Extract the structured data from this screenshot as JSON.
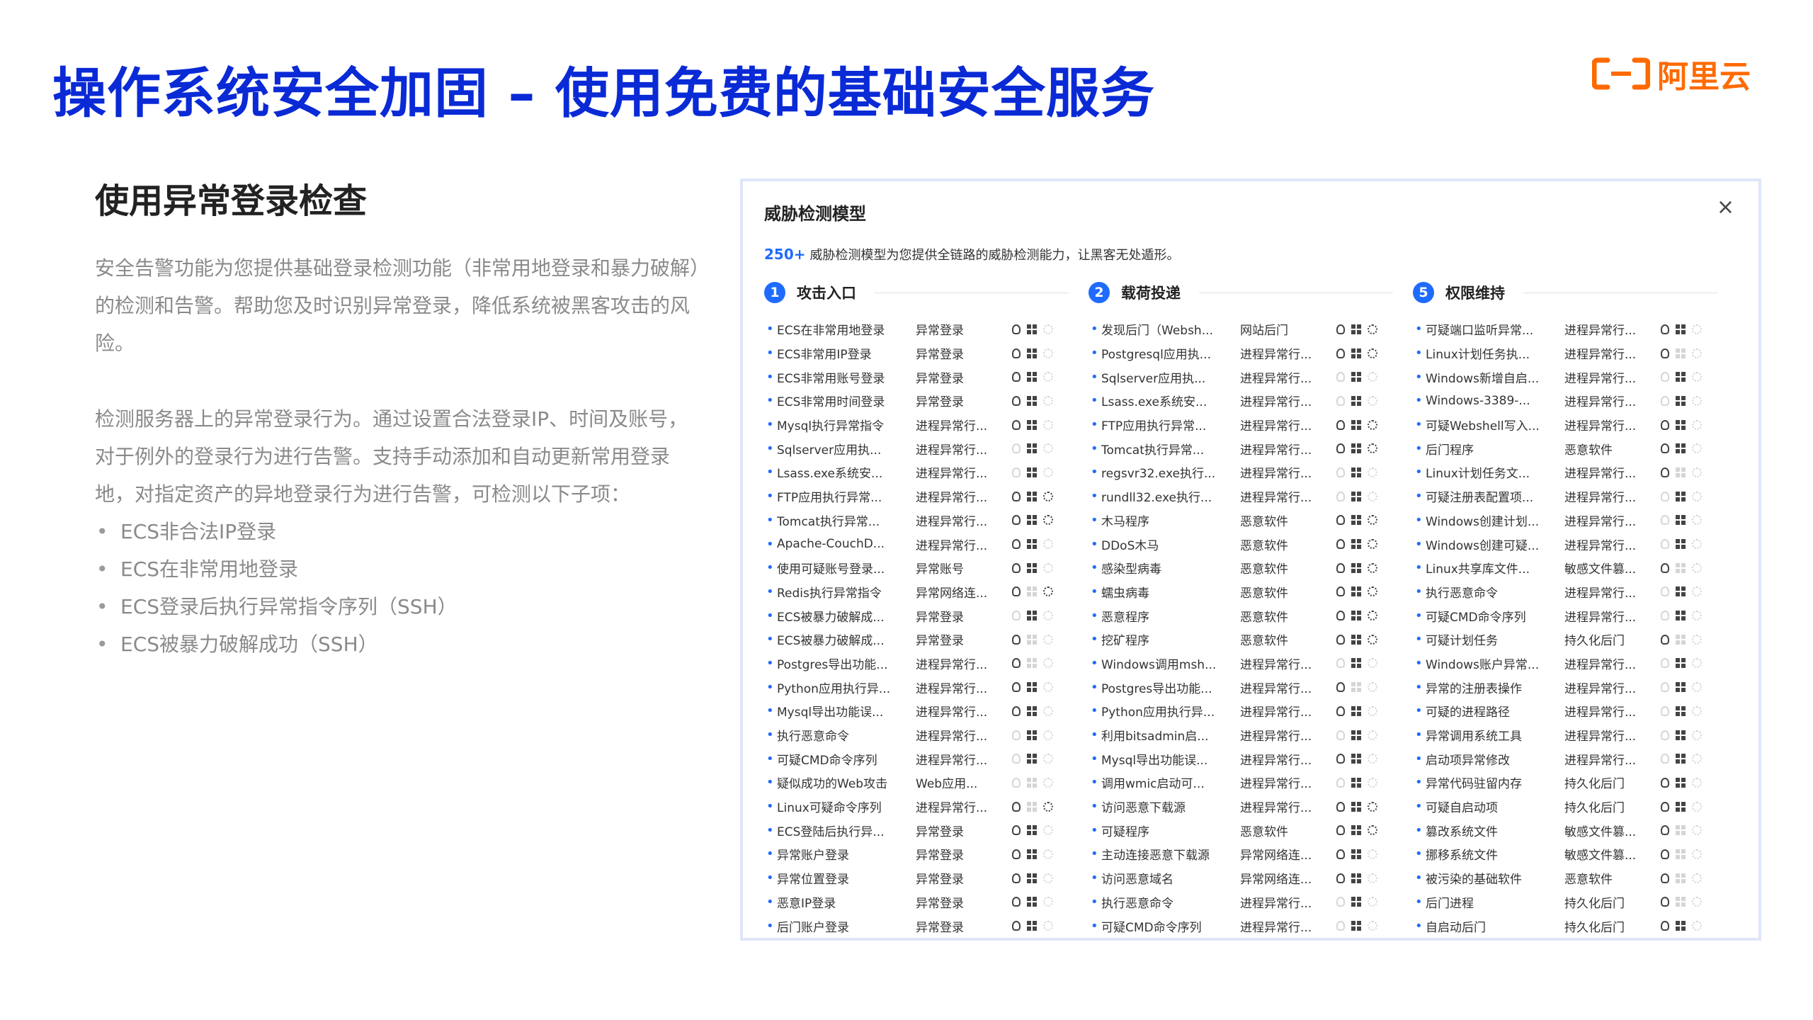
{
  "page": {
    "title": "操作系统安全加固 – 使用免费的基础安全服务",
    "brand": "阿里云"
  },
  "left": {
    "heading": "使用异常登录检查",
    "para1": "安全告警功能为您提供基础登录检测功能（非常用地登录和暴力破解）的检测和告警。帮助您及时识别异常登录，降低系统被黑客攻击的风险。",
    "para2": "检测服务器上的异常登录行为。通过设置合法登录IP、时间及账号，对于例外的登录行为进行告警。支持手动添加和自动更新常用登录地，对指定资产的异地登录行为进行告警，可检测以下子项：",
    "bullets": [
      "ECS非合法IP登录",
      "ECS在非常用地登录",
      "ECS登录后执行异常指令序列（SSH）",
      "ECS被暴力破解成功（SSH）"
    ]
  },
  "panel": {
    "title": "威胁检测模型",
    "close": "×",
    "subtitle_count": "250+",
    "subtitle_text": "威胁检测模型为您提供全链路的威胁检测能力，让黑客无处遁形。",
    "columns": [
      {
        "num": "1",
        "name": "攻击入口",
        "rows": [
          {
            "n": "ECS在非常用地登录",
            "c": "异常登录",
            "i": [
              1,
              1,
              0
            ]
          },
          {
            "n": "ECS非常用IP登录",
            "c": "异常登录",
            "i": [
              1,
              1,
              0
            ]
          },
          {
            "n": "ECS非常用账号登录",
            "c": "异常登录",
            "i": [
              1,
              1,
              0
            ]
          },
          {
            "n": "ECS非常用时间登录",
            "c": "异常登录",
            "i": [
              1,
              1,
              0
            ]
          },
          {
            "n": "Mysql执行异常指令",
            "c": "进程异常行...",
            "i": [
              1,
              1,
              0
            ]
          },
          {
            "n": "Sqlserver应用执...",
            "c": "进程异常行...",
            "i": [
              0,
              1,
              0
            ]
          },
          {
            "n": "Lsass.exe系统安...",
            "c": "进程异常行...",
            "i": [
              0,
              1,
              0
            ]
          },
          {
            "n": "FTP应用执行异常...",
            "c": "进程异常行...",
            "i": [
              1,
              1,
              1
            ]
          },
          {
            "n": "Tomcat执行异常...",
            "c": "进程异常行...",
            "i": [
              1,
              1,
              1
            ]
          },
          {
            "n": "Apache-CouchD...",
            "c": "进程异常行...",
            "i": [
              1,
              1,
              0
            ]
          },
          {
            "n": "使用可疑账号登录...",
            "c": "异常账号",
            "i": [
              1,
              1,
              0
            ]
          },
          {
            "n": "Redis执行异常指令",
            "c": "异常网络连...",
            "i": [
              1,
              0,
              1
            ]
          },
          {
            "n": "ECS被暴力破解成...",
            "c": "异常登录",
            "i": [
              0,
              1,
              0
            ]
          },
          {
            "n": "ECS被暴力破解成...",
            "c": "异常登录",
            "i": [
              1,
              0,
              0
            ]
          },
          {
            "n": "Postgres导出功能...",
            "c": "进程异常行...",
            "i": [
              1,
              0,
              0
            ]
          },
          {
            "n": "Python应用执行异...",
            "c": "进程异常行...",
            "i": [
              1,
              1,
              0
            ]
          },
          {
            "n": "Mysql导出功能误...",
            "c": "进程异常行...",
            "i": [
              1,
              1,
              0
            ]
          },
          {
            "n": "执行恶意命令",
            "c": "进程异常行...",
            "i": [
              0,
              1,
              0
            ]
          },
          {
            "n": "可疑CMD命令序列",
            "c": "进程异常行...",
            "i": [
              0,
              1,
              0
            ]
          },
          {
            "n": "疑似成功的Web攻击",
            "c": "Web应用...",
            "i": [
              0,
              0,
              0
            ]
          },
          {
            "n": "Linux可疑命令序列",
            "c": "进程异常行...",
            "i": [
              1,
              0,
              1
            ]
          },
          {
            "n": "ECS登陆后执行异...",
            "c": "异常登录",
            "i": [
              1,
              1,
              0
            ]
          },
          {
            "n": "异常账户登录",
            "c": "异常登录",
            "i": [
              1,
              1,
              0
            ]
          },
          {
            "n": "异常位置登录",
            "c": "异常登录",
            "i": [
              1,
              1,
              0
            ]
          },
          {
            "n": "恶意IP登录",
            "c": "异常登录",
            "i": [
              1,
              1,
              0
            ]
          },
          {
            "n": "后门账户登录",
            "c": "异常登录",
            "i": [
              1,
              1,
              0
            ]
          }
        ]
      },
      {
        "num": "2",
        "name": "载荷投递",
        "rows": [
          {
            "n": "发现后门（Websh...",
            "c": "网站后门",
            "i": [
              1,
              1,
              1
            ]
          },
          {
            "n": "Postgresql应用执...",
            "c": "进程异常行...",
            "i": [
              1,
              1,
              1
            ]
          },
          {
            "n": "Sqlserver应用执...",
            "c": "进程异常行...",
            "i": [
              0,
              1,
              0
            ]
          },
          {
            "n": "Lsass.exe系统安...",
            "c": "进程异常行...",
            "i": [
              0,
              1,
              0
            ]
          },
          {
            "n": "FTP应用执行异常...",
            "c": "进程异常行...",
            "i": [
              1,
              1,
              1
            ]
          },
          {
            "n": "Tomcat执行异常...",
            "c": "进程异常行...",
            "i": [
              1,
              1,
              1
            ]
          },
          {
            "n": "regsvr32.exe执行...",
            "c": "进程异常行...",
            "i": [
              0,
              1,
              0
            ]
          },
          {
            "n": "rundll32.exe执行...",
            "c": "进程异常行...",
            "i": [
              0,
              1,
              0
            ]
          },
          {
            "n": "木马程序",
            "c": "恶意软件",
            "i": [
              1,
              1,
              1
            ]
          },
          {
            "n": "DDoS木马",
            "c": "恶意软件",
            "i": [
              1,
              1,
              1
            ]
          },
          {
            "n": "感染型病毒",
            "c": "恶意软件",
            "i": [
              1,
              1,
              1
            ]
          },
          {
            "n": "蠕虫病毒",
            "c": "恶意软件",
            "i": [
              1,
              1,
              1
            ]
          },
          {
            "n": "恶意程序",
            "c": "恶意软件",
            "i": [
              1,
              1,
              1
            ]
          },
          {
            "n": "挖矿程序",
            "c": "恶意软件",
            "i": [
              1,
              1,
              1
            ]
          },
          {
            "n": "Windows调用msh...",
            "c": "进程异常行...",
            "i": [
              0,
              1,
              0
            ]
          },
          {
            "n": "Postgres导出功能...",
            "c": "进程异常行...",
            "i": [
              1,
              0,
              0
            ]
          },
          {
            "n": "Python应用执行异...",
            "c": "进程异常行...",
            "i": [
              1,
              1,
              0
            ]
          },
          {
            "n": "利用bitsadmin启...",
            "c": "进程异常行...",
            "i": [
              0,
              1,
              0
            ]
          },
          {
            "n": "Mysql导出功能误...",
            "c": "进程异常行...",
            "i": [
              1,
              1,
              0
            ]
          },
          {
            "n": "调用wmic启动可...",
            "c": "进程异常行...",
            "i": [
              0,
              1,
              0
            ]
          },
          {
            "n": "访问恶意下载源",
            "c": "进程异常行...",
            "i": [
              1,
              1,
              1
            ]
          },
          {
            "n": "可疑程序",
            "c": "恶意软件",
            "i": [
              1,
              1,
              1
            ]
          },
          {
            "n": "主动连接恶意下载源",
            "c": "异常网络连...",
            "i": [
              1,
              1,
              0
            ]
          },
          {
            "n": "访问恶意域名",
            "c": "异常网络连...",
            "i": [
              1,
              1,
              0
            ]
          },
          {
            "n": "执行恶意命令",
            "c": "进程异常行...",
            "i": [
              0,
              1,
              0
            ]
          },
          {
            "n": "可疑CMD命令序列",
            "c": "进程异常行...",
            "i": [
              0,
              1,
              0
            ]
          }
        ]
      },
      {
        "num": "5",
        "name": "权限维持",
        "rows": [
          {
            "n": "可疑端口监听异常...",
            "c": "进程异常行...",
            "i": [
              1,
              1,
              0
            ]
          },
          {
            "n": "Linux计划任务执...",
            "c": "进程异常行...",
            "i": [
              1,
              0,
              0
            ]
          },
          {
            "n": "Windows新增自启...",
            "c": "进程异常行...",
            "i": [
              0,
              1,
              0
            ]
          },
          {
            "n": "Windows-3389-...",
            "c": "进程异常行...",
            "i": [
              0,
              1,
              0
            ]
          },
          {
            "n": "可疑Webshell写入...",
            "c": "进程异常行...",
            "i": [
              1,
              1,
              0
            ]
          },
          {
            "n": "后门程序",
            "c": "恶意软件",
            "i": [
              1,
              1,
              0
            ]
          },
          {
            "n": "Linux计划任务文...",
            "c": "进程异常行...",
            "i": [
              1,
              0,
              0
            ]
          },
          {
            "n": "可疑注册表配置项...",
            "c": "进程异常行...",
            "i": [
              0,
              1,
              0
            ]
          },
          {
            "n": "Windows创建计划...",
            "c": "进程异常行...",
            "i": [
              0,
              1,
              0
            ]
          },
          {
            "n": "Windows创建可疑...",
            "c": "进程异常行...",
            "i": [
              0,
              1,
              0
            ]
          },
          {
            "n": "Linux共享库文件...",
            "c": "敏感文件篡...",
            "i": [
              1,
              0,
              0
            ]
          },
          {
            "n": "执行恶意命令",
            "c": "进程异常行...",
            "i": [
              0,
              1,
              0
            ]
          },
          {
            "n": "可疑CMD命令序列",
            "c": "进程异常行...",
            "i": [
              0,
              1,
              0
            ]
          },
          {
            "n": "可疑计划任务",
            "c": "持久化后门",
            "i": [
              1,
              0,
              0
            ]
          },
          {
            "n": "Windows账户异常...",
            "c": "进程异常行...",
            "i": [
              0,
              1,
              0
            ]
          },
          {
            "n": "异常的注册表操作",
            "c": "进程异常行...",
            "i": [
              0,
              1,
              0
            ]
          },
          {
            "n": "可疑的进程路径",
            "c": "进程异常行...",
            "i": [
              0,
              1,
              0
            ]
          },
          {
            "n": "异常调用系统工具",
            "c": "进程异常行...",
            "i": [
              0,
              1,
              0
            ]
          },
          {
            "n": "启动项异常修改",
            "c": "进程异常行...",
            "i": [
              0,
              1,
              0
            ]
          },
          {
            "n": "异常代码驻留内存",
            "c": "持久化后门",
            "i": [
              1,
              1,
              0
            ]
          },
          {
            "n": "可疑自启动项",
            "c": "持久化后门",
            "i": [
              1,
              1,
              0
            ]
          },
          {
            "n": "篡改系统文件",
            "c": "敏感文件篡...",
            "i": [
              1,
              0,
              0
            ]
          },
          {
            "n": "挪移系统文件",
            "c": "敏感文件篡...",
            "i": [
              1,
              0,
              0
            ]
          },
          {
            "n": "被污染的基础软件",
            "c": "恶意软件",
            "i": [
              1,
              0,
              0
            ]
          },
          {
            "n": "后门进程",
            "c": "持久化后门",
            "i": [
              1,
              0,
              0
            ]
          },
          {
            "n": "自启动后门",
            "c": "持久化后门",
            "i": [
              1,
              1,
              0
            ]
          }
        ]
      }
    ]
  },
  "icons": [
    "linux-icon",
    "windows-icon",
    "kubernetes-icon"
  ],
  "colors": {
    "title": "#0a2ad6",
    "brand": "#ff6a00",
    "accent": "#1f6bff",
    "muted_text": "#8a8a8a"
  }
}
